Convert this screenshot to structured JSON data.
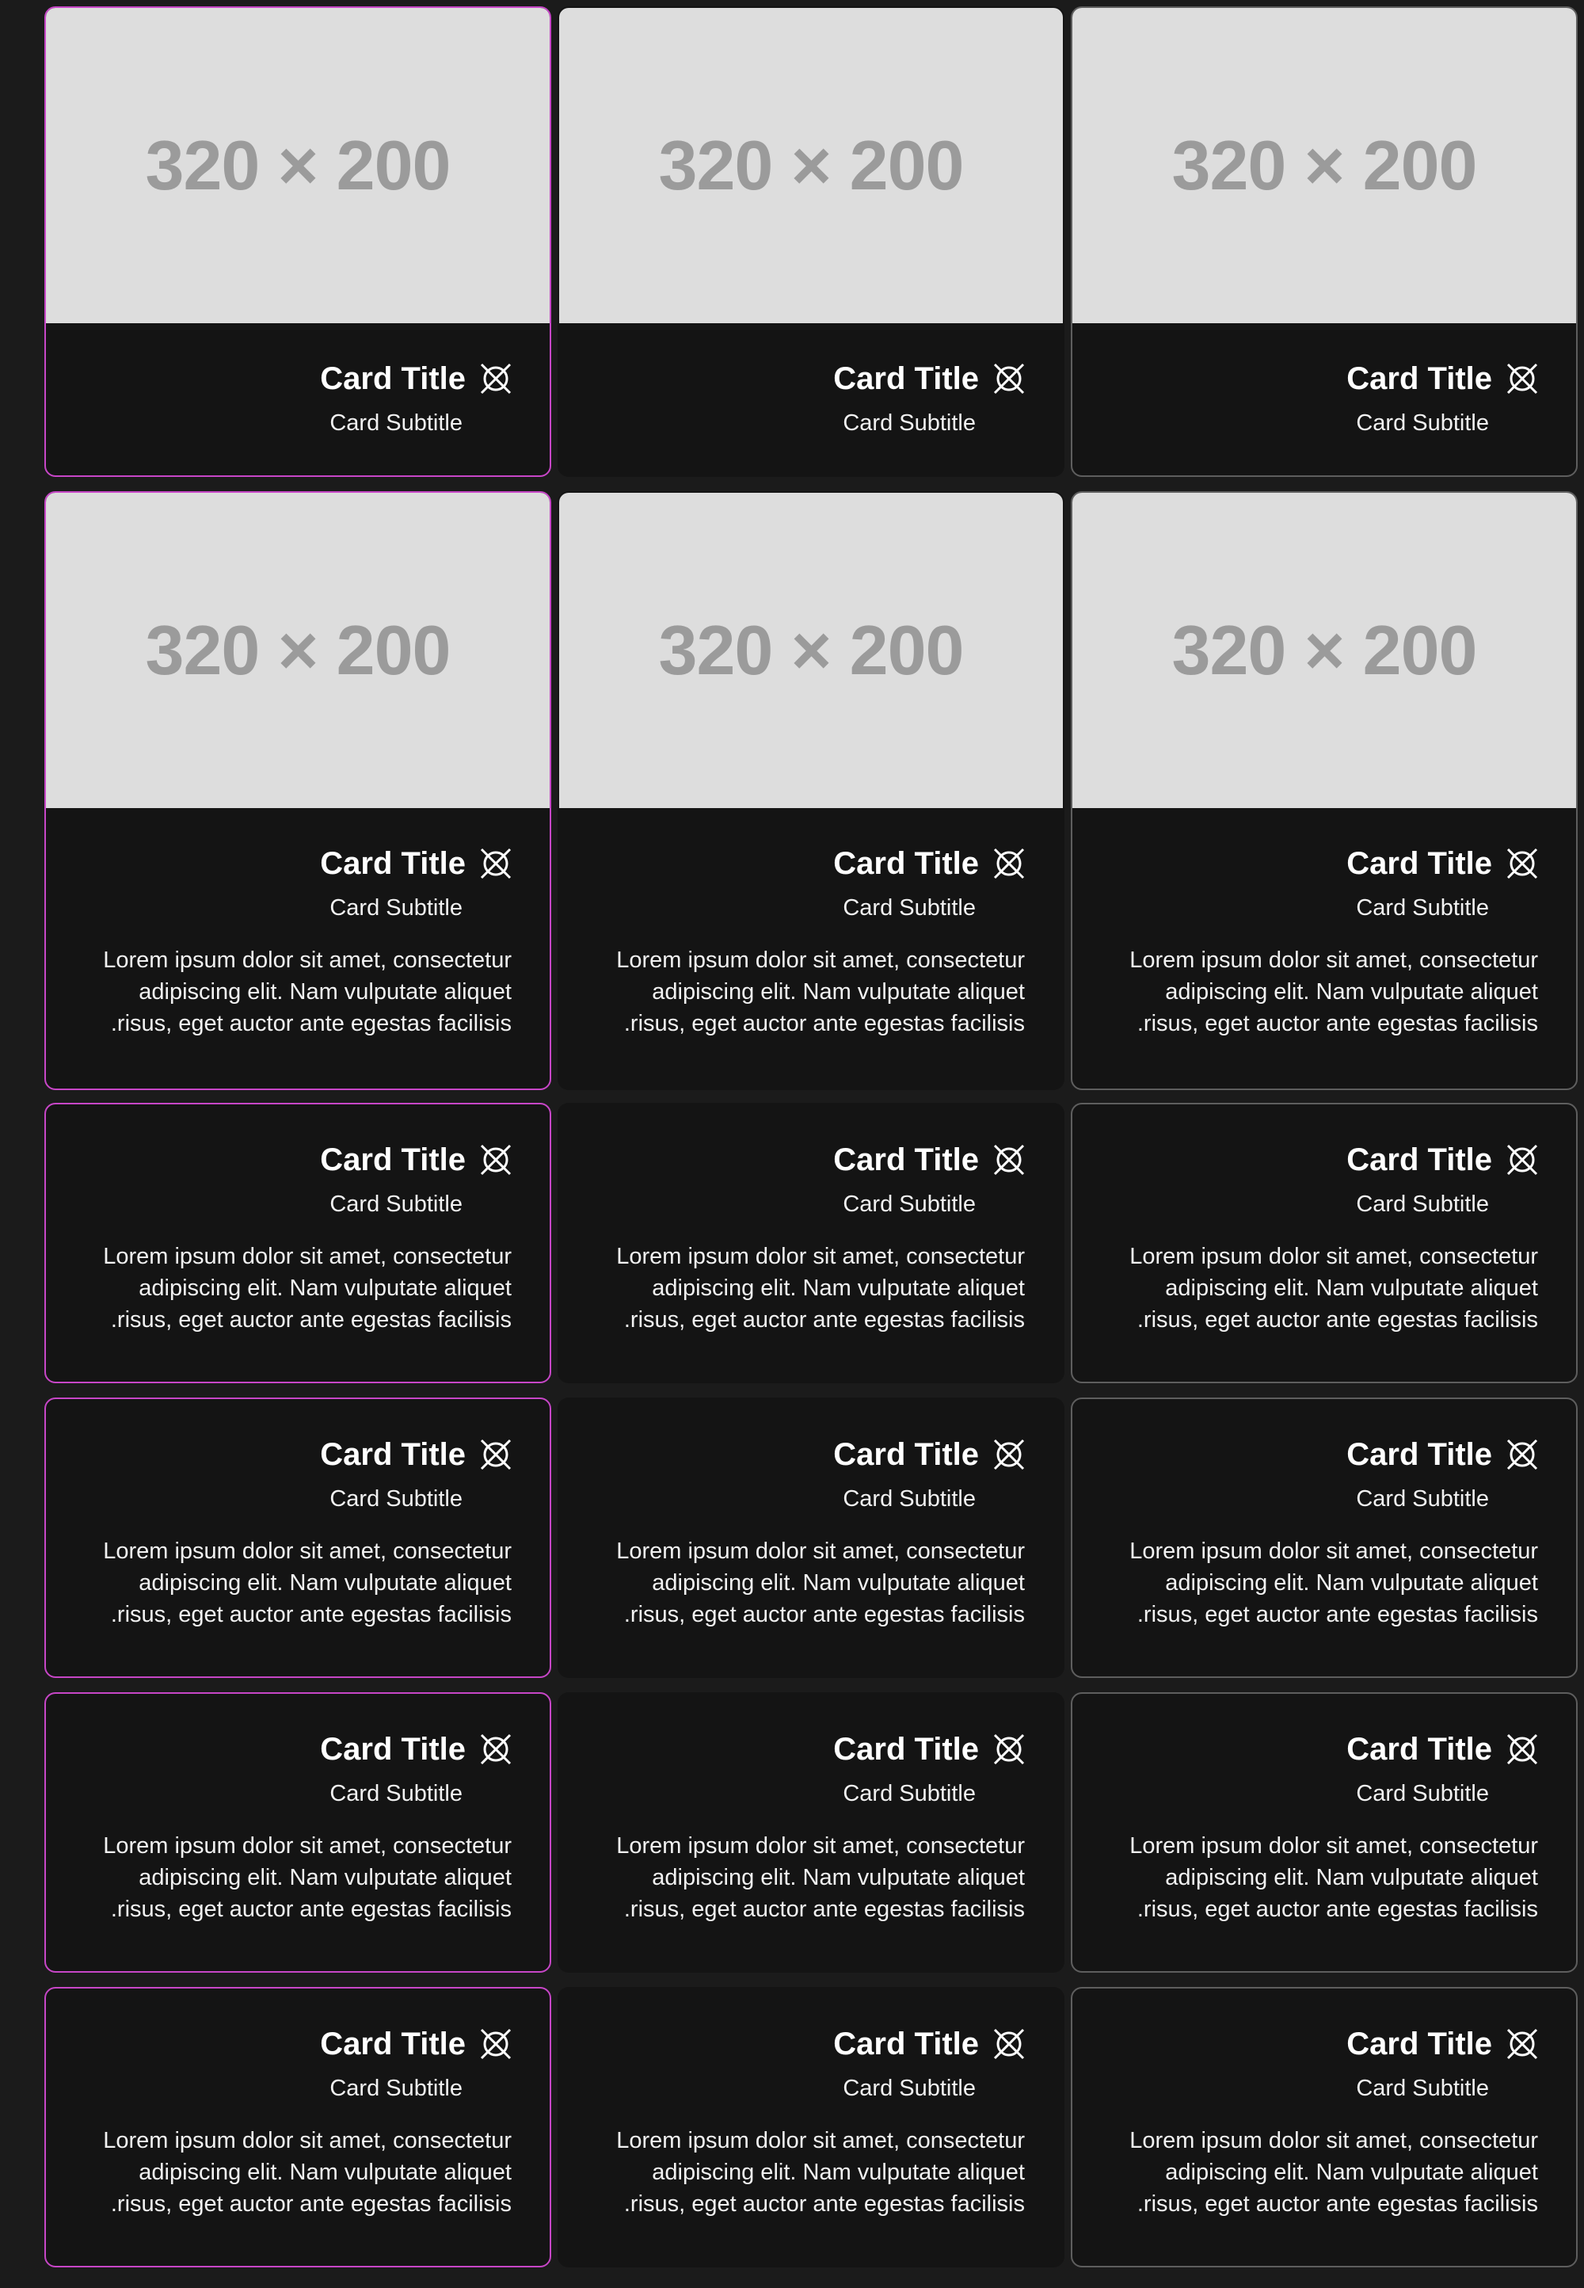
{
  "media_text": "320 × 200",
  "card_title": "Card Title",
  "card_subtitle": "Card Subtitle",
  "card_body_lines": [
    "Lorem ipsum dolor sit amet, consectetur",
    "adipiscing elit. Nam vulputate aliquet",
    "risus, eget auctor ante egestas facilisis."
  ],
  "icons": {
    "title_icon": "crossed-circle-icon"
  },
  "colors": {
    "page_bg": "#1b1b1b",
    "card_bg": "#141414",
    "accent_border": "#c746c7",
    "muted_border": "#5e5e5e",
    "placeholder_bg": "#dddddd",
    "placeholder_text": "#9b9b9b"
  }
}
